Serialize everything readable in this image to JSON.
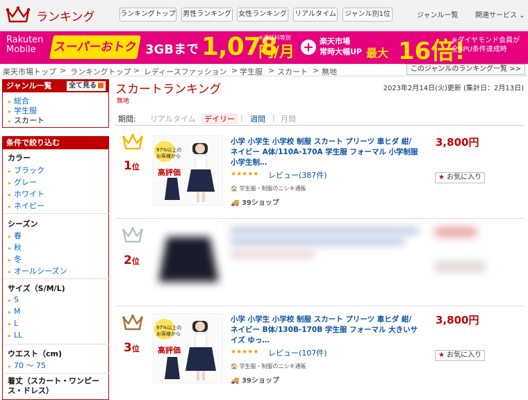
{
  "header": {
    "logo_text": "ランキング",
    "nav_buttons": [
      "ランキングトップ",
      "男性ランキング",
      "女性ランキング",
      "リアルタイム",
      "ジャンル別1位"
    ],
    "genre_list": "ジャンル一覧",
    "related_services": "関連サービス"
  },
  "promo": {
    "brand_top": "Rakuten",
    "brand_bottom": "Mobile",
    "super_deal": "スーパーおトク",
    "gb": "3GBまで",
    "price": "1,078",
    "price_note": "※通話料等別",
    "price_unit": "円/月",
    "ichiba_line1": "楽天市場",
    "ichiba_line2": "常時大幅UP",
    "max": "最大",
    "times": "16倍!",
    "diamond_line1": "※ダイヤモンド会員が",
    "diamond_line2": "全SPU条件達成時"
  },
  "breadcrumb": [
    "楽天市場トップ",
    "ランキングトップ",
    "レディースファッション",
    "学生服",
    "スカート",
    "無地"
  ],
  "genre_ranking_link": "このジャンルのランキング一覧 >>",
  "sidebar": {
    "genre_title": "ジャンル一覧",
    "see_all": "全て見る",
    "genres": [
      "総合",
      "学生服",
      "スカート"
    ],
    "filter_title": "条件で絞り込む",
    "color_title": "カラー",
    "colors": [
      "ブラック",
      "グレー",
      "ホワイト",
      "ネイビー"
    ],
    "season_title": "シーズン",
    "seasons": [
      "春",
      "秋",
      "冬",
      "オールシーズン"
    ],
    "size_title": "サイズ（S/M/L)",
    "sizes": [
      "S",
      "M",
      "L",
      "LL"
    ],
    "waist_title": "ウエスト（cm)",
    "waists": [
      "70 ～ 75"
    ],
    "length_title": "着丈（スカート・ワンピース・ドレス）"
  },
  "main": {
    "title": "スカートランキング",
    "subtitle": "無地",
    "updated": "2023年2月14日(火)更新 (集計日：2月13日)",
    "period_label": "期間:",
    "periods": [
      "リアルタイム",
      "デイリー",
      "週間",
      "月間"
    ]
  },
  "items": [
    {
      "rank": "1",
      "rank_suffix": "位",
      "title": "小学 小学生 小学校 制服 スカート プリーツ 車ヒダ 紺/ネイビー A体/110A-170A 学生服 フォーマル 小学制服 小学生制…",
      "rating_stars": "★★★★★",
      "review": "レビュー(387件)",
      "shop_tag": "学生服・制服のニシキ通販",
      "shop": "39ショップ",
      "price": "3,800円",
      "fav": "お気に入り",
      "thumb_badge": "97%以上の お客様から",
      "thumb_label": "高評価",
      "crown_color": "#f2b705"
    },
    {
      "rank": "2",
      "rank_suffix": "位",
      "crown_color": "#b8c2cc"
    },
    {
      "rank": "3",
      "rank_suffix": "位",
      "title": "小学 小学生 小学校 制服 スカート プリーツ 車ヒダ 紺/ネイビー B体/130B-170B 学生服 フォーマル 大きいサイズ ゆっ…",
      "rating_stars": "★★★★★",
      "review": "レビュー(107件)",
      "shop_tag": "学生服・制服のニシキ通販",
      "shop": "39ショップ",
      "price": "3,800円",
      "fav": "お気に入り",
      "thumb_badge": "97%以上の お客様から",
      "thumb_label": "高評価",
      "crown_color": "#a8743a"
    }
  ],
  "colors": {
    "brand_red": "#bf0000",
    "promo_pink": "#e6007e",
    "link_blue": "#0b4fa0"
  }
}
